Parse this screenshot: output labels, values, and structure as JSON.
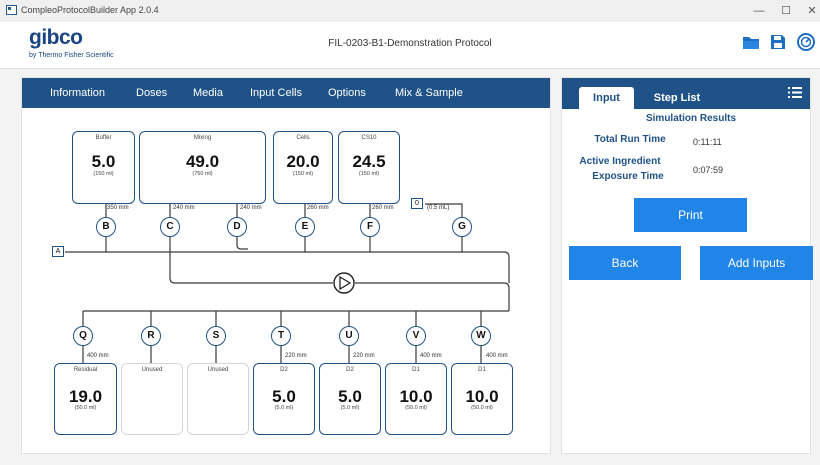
{
  "window": {
    "title": "CompleoProtocolBuilder App 2.0.4",
    "minimize": "—",
    "maximize": "☐",
    "close": "✕"
  },
  "header": {
    "logo_main": "gibco",
    "logo_sub": "by Thermo Fisher Scientific",
    "protocol_name": "FIL-0203-B1-Demonstration Protocol"
  },
  "colors": {
    "nav_bg": "#1f5286",
    "button_bg": "#2185e8",
    "border": "#1f5286"
  },
  "nav": [
    "Information",
    "Doses",
    "Media",
    "Input Cells",
    "Options",
    "Mix & Sample"
  ],
  "diagram": {
    "top_containers": [
      {
        "label": "Buffer",
        "value": "5.0",
        "volume": "(150 ml)"
      },
      {
        "label": "Mixing",
        "value": "49.0",
        "volume": "(750 ml)"
      },
      {
        "label": "Cells",
        "value": "20.0",
        "volume": "(150 ml)"
      },
      {
        "label": "CS10",
        "value": "24.5",
        "volume": "(150 ml)"
      }
    ],
    "top_valves": [
      "B",
      "C",
      "D",
      "E",
      "F",
      "G"
    ],
    "top_lengths": [
      "350 mm",
      "240 mm",
      "240 mm",
      "260 mm",
      "260 mm"
    ],
    "sample_tag": "0",
    "sample_volume": "(0.5 mL)",
    "a_tag": "A",
    "bottom_valves": [
      "Q",
      "R",
      "S",
      "T",
      "U",
      "V",
      "W"
    ],
    "bottom_lengths": [
      "400 mm",
      "220 mm",
      "220 mm",
      "400 mm",
      "400 mm"
    ],
    "bottom_containers": [
      {
        "label": "Residual",
        "value": "19.0",
        "volume": "(50.0 ml)",
        "unused": false
      },
      {
        "label": "Unused",
        "value": "",
        "volume": "",
        "unused": true
      },
      {
        "label": "Unused",
        "value": "",
        "volume": "",
        "unused": true
      },
      {
        "label": "D2",
        "value": "5.0",
        "volume": "(5.0 ml)",
        "unused": false
      },
      {
        "label": "D2",
        "value": "5.0",
        "volume": "(5.0 ml)",
        "unused": false
      },
      {
        "label": "D1",
        "value": "10.0",
        "volume": "(50.0 ml)",
        "unused": false
      },
      {
        "label": "D1",
        "value": "10.0",
        "volume": "(50.0 ml)",
        "unused": false
      }
    ]
  },
  "right": {
    "tabs": [
      "Input",
      "Step List"
    ],
    "sim_title": "Simulation Results",
    "total_run_label": "Total Run Time",
    "total_run_value": "0:11:11",
    "exposure_label_1": "Active Ingredient",
    "exposure_label_2": "Exposure Time",
    "exposure_value": "0:07:59",
    "print_label": "Print",
    "back_label": "Back",
    "add_inputs_label": "Add Inputs"
  }
}
